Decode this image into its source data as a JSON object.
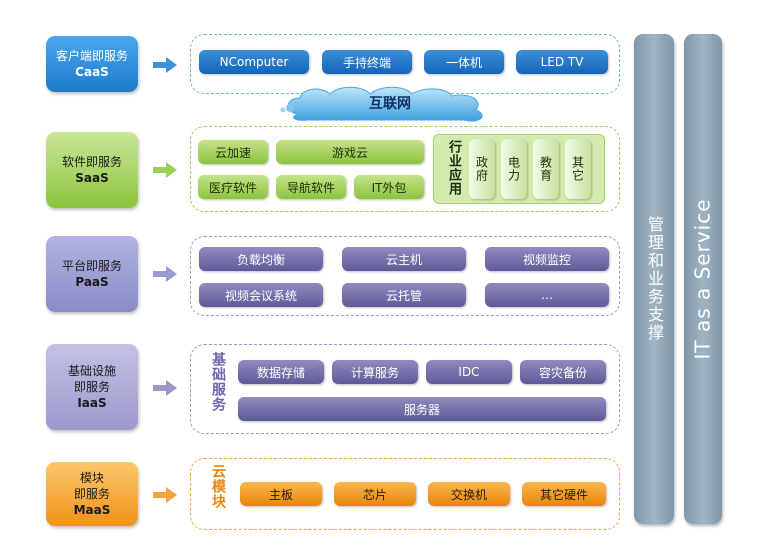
{
  "layers": {
    "caas": {
      "line1": "客户端即服务",
      "code": "CaaS",
      "color": "#2a8ad6"
    },
    "saas": {
      "line1": "软件即服务",
      "code": "SaaS",
      "color": "#8cc43c"
    },
    "paas": {
      "line1": "平台即服务",
      "code": "PaaS",
      "color": "#7d7fc0"
    },
    "iaas": {
      "line1": "基础设施",
      "line2": "即服务",
      "code": "IaaS",
      "color": "#8a86c0"
    },
    "maas": {
      "line1": "模块",
      "line2": "即服务",
      "code": "MaaS",
      "color": "#f39a1c"
    }
  },
  "caas_items": [
    "NComputer",
    "手持终端",
    "一体机",
    "LED TV"
  ],
  "internet_label": "互联网",
  "saas_items": {
    "row1": [
      "云加速",
      "游戏云"
    ],
    "row2": [
      "医疗软件",
      "导航软件",
      "IT外包"
    ],
    "industry_title": "行业应用",
    "industry_items": [
      "政府",
      "电力",
      "教育",
      "其它"
    ]
  },
  "paas_items": [
    "负载均衡",
    "云主机",
    "视频监控",
    "视频会议系统",
    "云托管",
    "…"
  ],
  "iaas_items": {
    "title": "基础服务",
    "row1": [
      "数据存储",
      "计算服务",
      "IDC",
      "容灾备份"
    ],
    "row2": "服务器"
  },
  "maas_items": {
    "title": "云模块",
    "items": [
      "主板",
      "芯片",
      "交换机",
      "其它硬件"
    ]
  },
  "side_columns": {
    "management": "管理和业务支撑",
    "itaas": "IT as a Service"
  }
}
